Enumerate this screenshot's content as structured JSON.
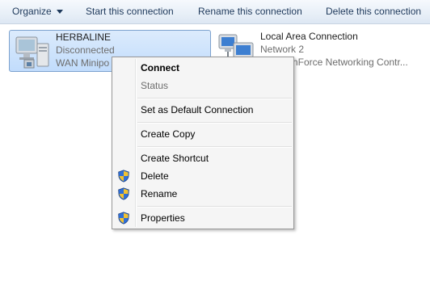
{
  "toolbar": {
    "organize": "Organize",
    "start": "Start this connection",
    "rename": "Rename this connection",
    "delete": "Delete this connection"
  },
  "connections": [
    {
      "name": "HERBALINE",
      "status": "Disconnected",
      "device": "WAN Minipo",
      "icon": "dialup-computer-icon"
    },
    {
      "name": "Local Area Connection",
      "status": "Network  2",
      "device": "nForce Networking Contr...",
      "icon": "network-computers-icon"
    }
  ],
  "menu": {
    "connect": "Connect",
    "status": "Status",
    "set_default": "Set as Default Connection",
    "create_copy": "Create Copy",
    "create_shortcut": "Create Shortcut",
    "delete": "Delete",
    "rename": "Rename",
    "properties": "Properties"
  }
}
